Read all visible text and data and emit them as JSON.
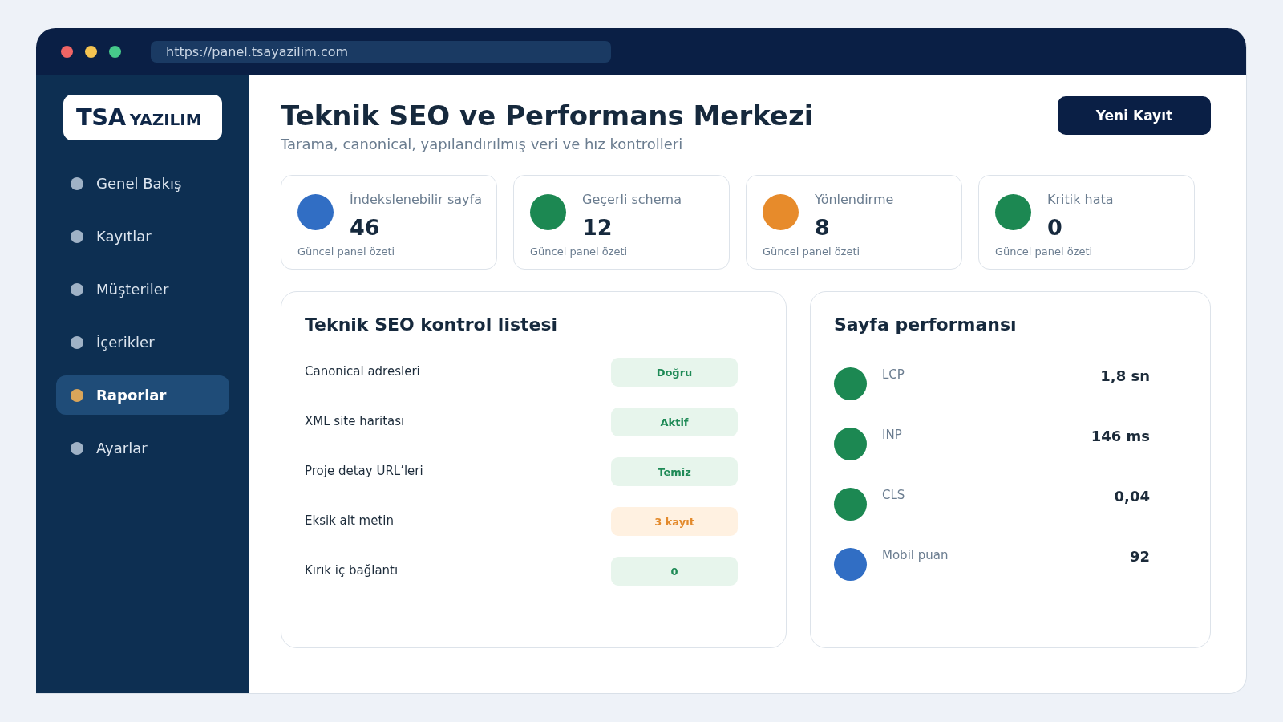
{
  "browser": {
    "url": "https://panel.tsayazilim.com"
  },
  "sidebar": {
    "logo": {
      "primary": "TSA",
      "secondary": "YAZILIM"
    },
    "items": [
      {
        "label": "Genel Bakış",
        "selected": false
      },
      {
        "label": "Kayıtlar",
        "selected": false
      },
      {
        "label": "Müşteriler",
        "selected": false
      },
      {
        "label": "İçerikler",
        "selected": false
      },
      {
        "label": "Raporlar",
        "selected": true
      },
      {
        "label": "Ayarlar",
        "selected": false
      }
    ]
  },
  "header": {
    "title": "Teknik SEO ve Performans Merkezi",
    "subtitle": "Tarama, canonical, yapılandırılmış veri ve hız kontrolleri",
    "button": "Yeni Kayıt"
  },
  "stats": [
    {
      "label": "İndekslenebilir sayfa",
      "value": "46",
      "note": "Güncel panel özeti",
      "color": "#316ec4"
    },
    {
      "label": "Geçerli schema",
      "value": "12",
      "note": "Güncel panel özeti",
      "color": "#1c8852"
    },
    {
      "label": "Yönlendirme",
      "value": "8",
      "note": "Güncel panel özeti",
      "color": "#e78b2b"
    },
    {
      "label": "Kritik hata",
      "value": "0",
      "note": "Güncel panel özeti",
      "color": "#1c8852"
    }
  ],
  "checklist": {
    "title": "Teknik SEO kontrol listesi",
    "items": [
      {
        "label": "Canonical adresleri",
        "status": "Doğru",
        "kind": "success"
      },
      {
        "label": "XML site haritası",
        "status": "Aktif",
        "kind": "success"
      },
      {
        "label": "Proje detay URL’leri",
        "status": "Temiz",
        "kind": "success"
      },
      {
        "label": "Eksik alt metin",
        "status": "3 kayıt",
        "kind": "warning"
      },
      {
        "label": "Kırık iç bağlantı",
        "status": "0",
        "kind": "success"
      }
    ]
  },
  "performance": {
    "title": "Sayfa performansı",
    "metrics": [
      {
        "label": "LCP",
        "value": "1,8 sn",
        "color": "#1c8852"
      },
      {
        "label": "INP",
        "value": "146 ms",
        "color": "#1c8852"
      },
      {
        "label": "CLS",
        "value": "0,04",
        "color": "#1c8852"
      },
      {
        "label": "Mobil puan",
        "value": "92",
        "color": "#316ec4"
      }
    ]
  }
}
